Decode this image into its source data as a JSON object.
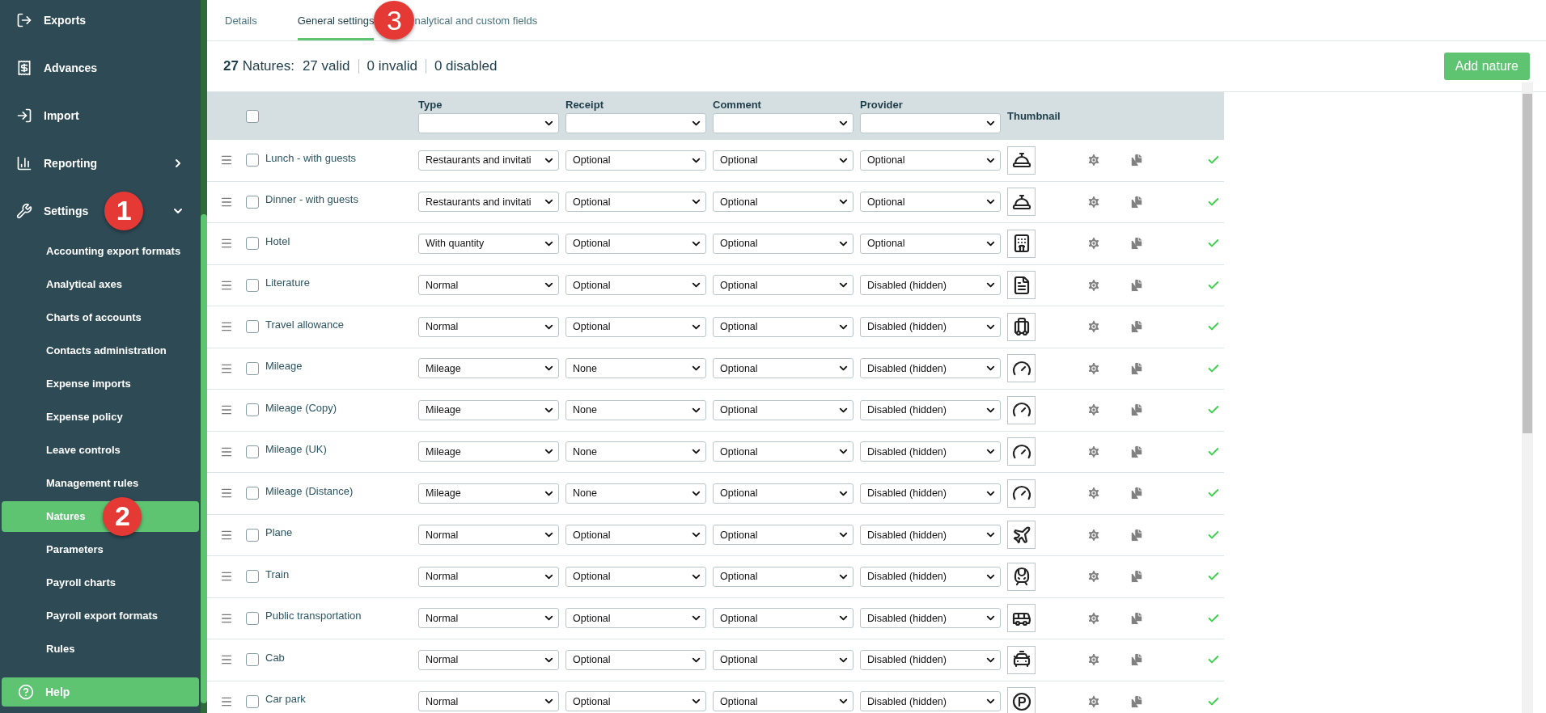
{
  "sidebar": {
    "items": [
      {
        "label": "Exports",
        "kind": "exports"
      },
      {
        "label": "Advances",
        "kind": "advances"
      },
      {
        "label": "Import",
        "kind": "import"
      },
      {
        "label": "Reporting",
        "kind": "reporting",
        "expanded": false
      },
      {
        "label": "Settings",
        "kind": "settings",
        "expanded": true,
        "badge": "1",
        "children": [
          {
            "label": "Accounting export formats",
            "selected": false
          },
          {
            "label": "Analytical axes",
            "selected": false
          },
          {
            "label": "Charts of accounts",
            "selected": false
          },
          {
            "label": "Contacts administration",
            "selected": false
          },
          {
            "label": "Expense imports",
            "selected": false
          },
          {
            "label": "Expense policy",
            "selected": false
          },
          {
            "label": "Leave controls",
            "selected": false
          },
          {
            "label": "Management rules",
            "selected": false
          },
          {
            "label": "Natures",
            "selected": true,
            "badge": "2"
          },
          {
            "label": "Parameters",
            "selected": false
          },
          {
            "label": "Payroll charts",
            "selected": false
          },
          {
            "label": "Payroll export formats",
            "selected": false
          },
          {
            "label": "Rules",
            "selected": false
          }
        ]
      }
    ],
    "help": "Help"
  },
  "tabs": [
    {
      "label": "Details",
      "selected": false
    },
    {
      "label": "General settings",
      "selected": true,
      "badge": "3"
    },
    {
      "label": "nalytical and custom fields",
      "selected": false
    }
  ],
  "summary": {
    "count": "27",
    "label": "Natures:",
    "valid": "27 valid",
    "invalid": "0 invalid",
    "disabled": "0 disabled"
  },
  "add_button": "Add nature",
  "table": {
    "select_all": {
      "checked": false
    },
    "columns": [
      "Type",
      "Receipt",
      "Comment",
      "Provider",
      "Thumbnail"
    ],
    "rows": [
      {
        "name": "Lunch - with guests",
        "checked": false,
        "type": "Restaurants and invitati",
        "receipt": "Optional",
        "comment": "Optional",
        "provider": "Optional",
        "kind": "restaurant",
        "valid": true
      },
      {
        "name": "Dinner - with guests",
        "checked": false,
        "type": "Restaurants and invitati",
        "receipt": "Optional",
        "comment": "Optional",
        "provider": "Optional",
        "kind": "restaurant",
        "valid": true
      },
      {
        "name": "Hotel",
        "checked": false,
        "type": "With quantity",
        "receipt": "Optional",
        "comment": "Optional",
        "provider": "Optional",
        "kind": "hotel",
        "valid": true
      },
      {
        "name": "Literature",
        "checked": false,
        "type": "Normal",
        "receipt": "Optional",
        "comment": "Optional",
        "provider": "Disabled (hidden)",
        "kind": "document",
        "valid": true
      },
      {
        "name": "Travel allowance",
        "checked": false,
        "type": "Normal",
        "receipt": "Optional",
        "comment": "Optional",
        "provider": "Disabled (hidden)",
        "kind": "luggage",
        "valid": true
      },
      {
        "name": "Mileage",
        "checked": false,
        "type": "Mileage",
        "receipt": "None",
        "comment": "Optional",
        "provider": "Disabled (hidden)",
        "kind": "gauge",
        "valid": true
      },
      {
        "name": "Mileage (Copy)",
        "checked": false,
        "type": "Mileage",
        "receipt": "None",
        "comment": "Optional",
        "provider": "Disabled (hidden)",
        "kind": "gauge",
        "valid": true
      },
      {
        "name": "Mileage (UK)",
        "checked": false,
        "type": "Mileage",
        "receipt": "None",
        "comment": "Optional",
        "provider": "Disabled (hidden)",
        "kind": "gauge",
        "valid": true
      },
      {
        "name": "Mileage (Distance)",
        "checked": false,
        "type": "Mileage",
        "receipt": "None",
        "comment": "Optional",
        "provider": "Disabled (hidden)",
        "kind": "gauge",
        "valid": true
      },
      {
        "name": "Plane",
        "checked": false,
        "type": "Normal",
        "receipt": "Optional",
        "comment": "Optional",
        "provider": "Disabled (hidden)",
        "kind": "plane",
        "valid": true
      },
      {
        "name": "Train",
        "checked": false,
        "type": "Normal",
        "receipt": "Optional",
        "comment": "Optional",
        "provider": "Disabled (hidden)",
        "kind": "train",
        "valid": true
      },
      {
        "name": "Public transportation",
        "checked": false,
        "type": "Normal",
        "receipt": "Optional",
        "comment": "Optional",
        "provider": "Disabled (hidden)",
        "kind": "bus",
        "valid": true
      },
      {
        "name": "Cab",
        "checked": false,
        "type": "Normal",
        "receipt": "Optional",
        "comment": "Optional",
        "provider": "Disabled (hidden)",
        "kind": "taxi",
        "valid": true
      },
      {
        "name": "Car park",
        "checked": false,
        "type": "Normal",
        "receipt": "Optional",
        "comment": "Optional",
        "provider": "Disabled (hidden)",
        "kind": "parking",
        "valid": true
      }
    ]
  }
}
